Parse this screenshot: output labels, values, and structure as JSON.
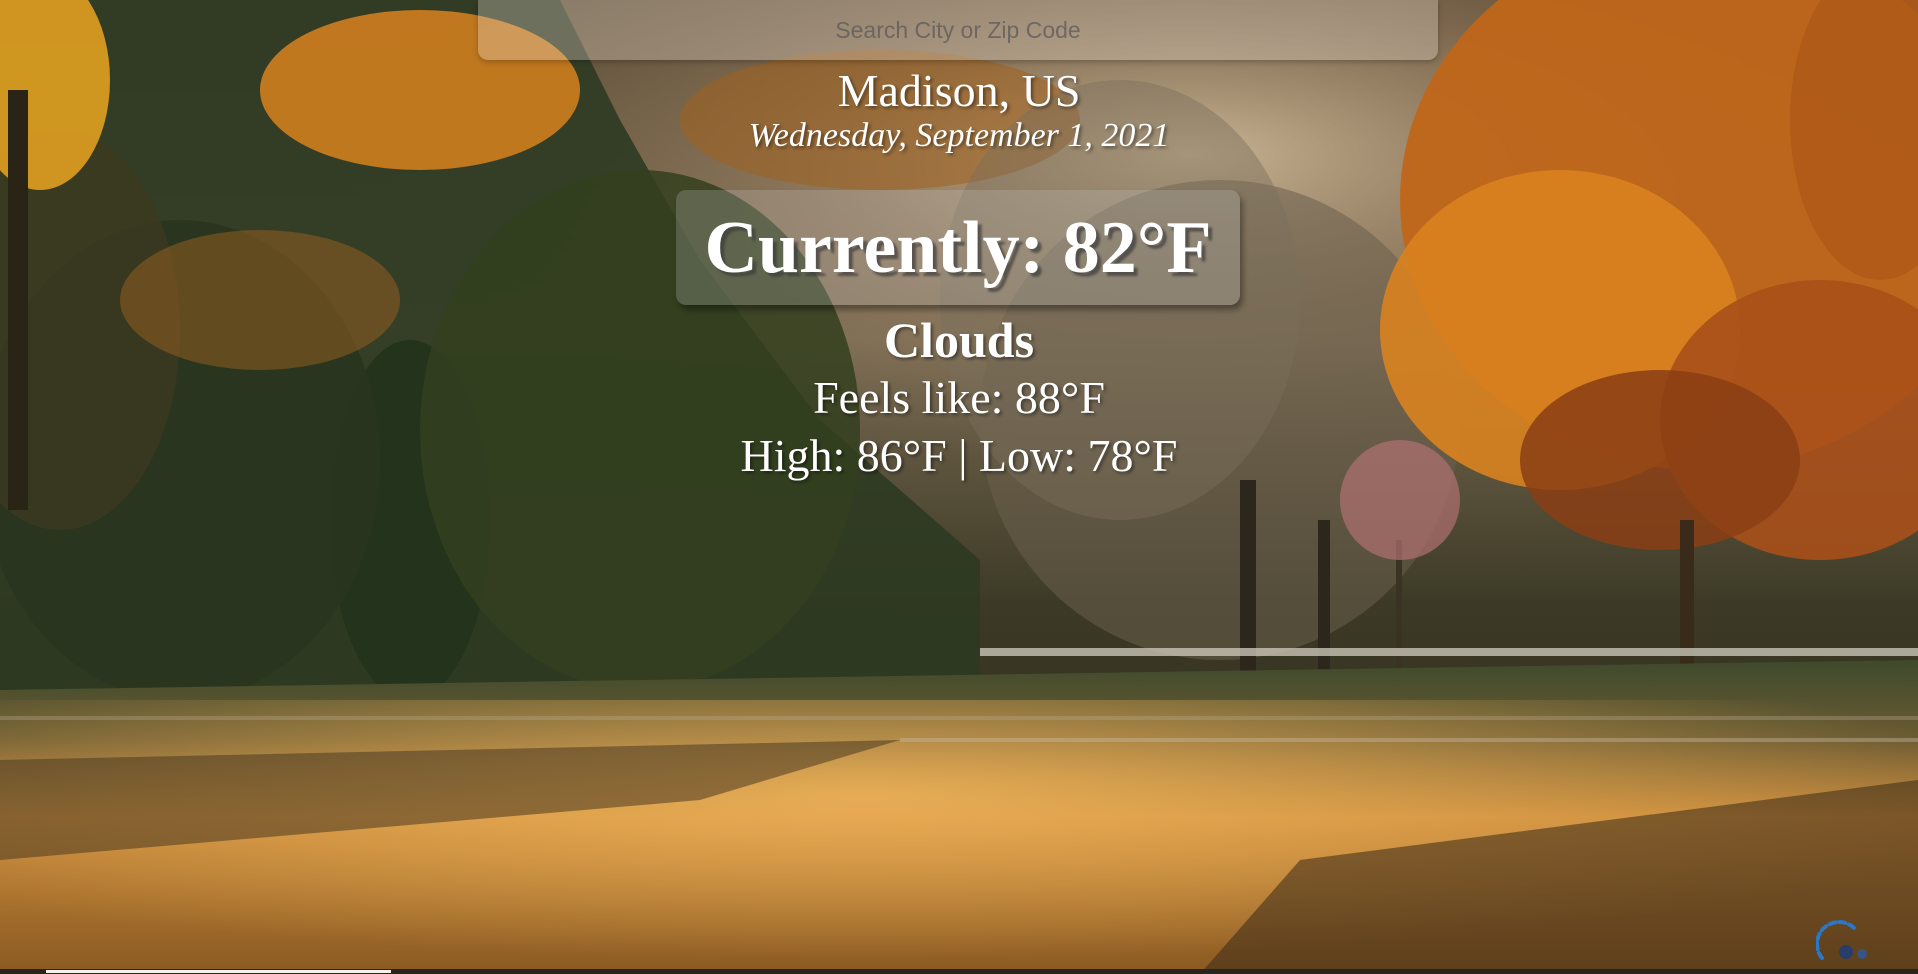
{
  "search": {
    "placeholder": "Search City or Zip Code"
  },
  "weather": {
    "location": "Madison, US",
    "date": "Wednesday, September 1, 2021",
    "currently": "Currently: 82°F",
    "condition": "Clouds",
    "feels_like": "Feels like: 88°F",
    "high_low": "High: 86°F | Low: 78°F"
  },
  "background": {
    "scene": "autumn park with sunlit lawn and trees",
    "colors": {
      "sky_haze": "#8a7a62",
      "foliage_orange": "#d9821f",
      "foliage_dark": "#2e3a22",
      "grass_sunlit": "#c98a3a",
      "grass_shadow": "#4a3a22"
    }
  },
  "icons": {
    "corner": "loading-spinner-icon"
  }
}
